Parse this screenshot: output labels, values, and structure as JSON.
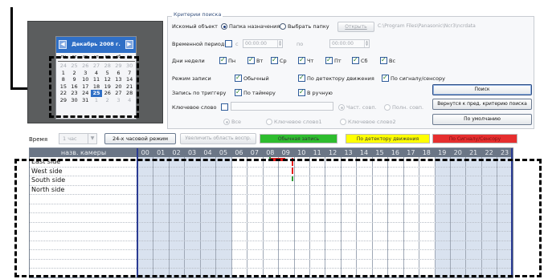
{
  "calendar": {
    "title": "Декабрь 2008 г.",
    "prev_icon": "arrow-left",
    "next_icon": "arrow-right",
    "weekdays": [
      "пн",
      "вт",
      "ср",
      "чт",
      "пт",
      "сб",
      "вс"
    ],
    "days": [
      {
        "d": "24",
        "other": true
      },
      {
        "d": "25",
        "other": true
      },
      {
        "d": "26",
        "other": true
      },
      {
        "d": "27",
        "other": true
      },
      {
        "d": "28",
        "other": true
      },
      {
        "d": "29",
        "other": true
      },
      {
        "d": "30",
        "other": true
      },
      {
        "d": "1"
      },
      {
        "d": "2"
      },
      {
        "d": "3"
      },
      {
        "d": "4"
      },
      {
        "d": "5"
      },
      {
        "d": "6"
      },
      {
        "d": "7"
      },
      {
        "d": "8"
      },
      {
        "d": "9"
      },
      {
        "d": "10"
      },
      {
        "d": "11"
      },
      {
        "d": "12"
      },
      {
        "d": "13"
      },
      {
        "d": "14"
      },
      {
        "d": "15"
      },
      {
        "d": "16"
      },
      {
        "d": "17"
      },
      {
        "d": "18"
      },
      {
        "d": "19"
      },
      {
        "d": "20"
      },
      {
        "d": "21"
      },
      {
        "d": "22"
      },
      {
        "d": "23"
      },
      {
        "d": "24"
      },
      {
        "d": "25",
        "selected": true
      },
      {
        "d": "26"
      },
      {
        "d": "27"
      },
      {
        "d": "28"
      },
      {
        "d": "29"
      },
      {
        "d": "30"
      },
      {
        "d": "31"
      },
      {
        "d": "1",
        "other": true
      },
      {
        "d": "2",
        "other": true
      },
      {
        "d": "3",
        "other": true
      },
      {
        "d": "4",
        "other": true
      }
    ]
  },
  "criteria": {
    "title": "Критерии поиска",
    "search_object_label": "Искомый объект",
    "radio_dest_folder": "Папка назначения",
    "radio_choose_folder": "Выбрать папку",
    "open_button": "Открыть",
    "folder_path": "C:\\Program Files\\Panasonic\\Ncr3\\ncrdata",
    "time_period_label": "Временной период",
    "from_label": "с",
    "to_label": "по",
    "time_from": "00:00:00",
    "time_to": "00:00:00",
    "weekdays_label": "Дни недели",
    "weekdays": [
      "Пн",
      "Вт",
      "Ср",
      "Чт",
      "Пт",
      "Сб",
      "Вс"
    ],
    "record_mode_label": "Режим записи",
    "mode_normal": "Обычный",
    "mode_motion": "По детектору движения",
    "mode_signal": "По сигналу/сенсору",
    "trigger_label": "Запись по триггеру",
    "trigger_timer": "По таймеру",
    "trigger_manual": "В ручную",
    "keyword_label": "Ключевое слово",
    "keyword_value": "",
    "partial_match": "Част. совп.",
    "full_match": "Полн. совп.",
    "kw_all": "Все",
    "kw_1": "Ключевое слово1",
    "kw_2": "Ключевое слово2",
    "search_button": "Поиск",
    "back_button": "Вернутся к пред. критерию поиска",
    "default_button": "По умолчанию"
  },
  "toolbar": {
    "time_label": "Время",
    "time_select": "1 час",
    "mode24_button": "24-х часовой режим",
    "zoom_button": "Увеличить область воспр.",
    "legend_normal": "Обычная запись",
    "legend_motion": "По детектору движения",
    "legend_signal": "По Сигналу/Сенсору",
    "colors": {
      "normal": "#2ebd2e",
      "motion": "#ffff00",
      "signal": "#e62e2e"
    }
  },
  "timeline": {
    "camera_header": "назв. камеры",
    "hours": [
      "00",
      "01",
      "02",
      "03",
      "04",
      "05",
      "06",
      "07",
      "08",
      "09",
      "10",
      "11",
      "12",
      "13",
      "14",
      "15",
      "16",
      "17",
      "18",
      "19",
      "20",
      "21",
      "22",
      "23"
    ],
    "night_hours": [
      "00",
      "01",
      "02",
      "03",
      "04",
      "05",
      "19",
      "20",
      "21",
      "22",
      "23"
    ],
    "cameras": [
      "East side",
      "West side",
      "South side",
      "North side"
    ]
  }
}
